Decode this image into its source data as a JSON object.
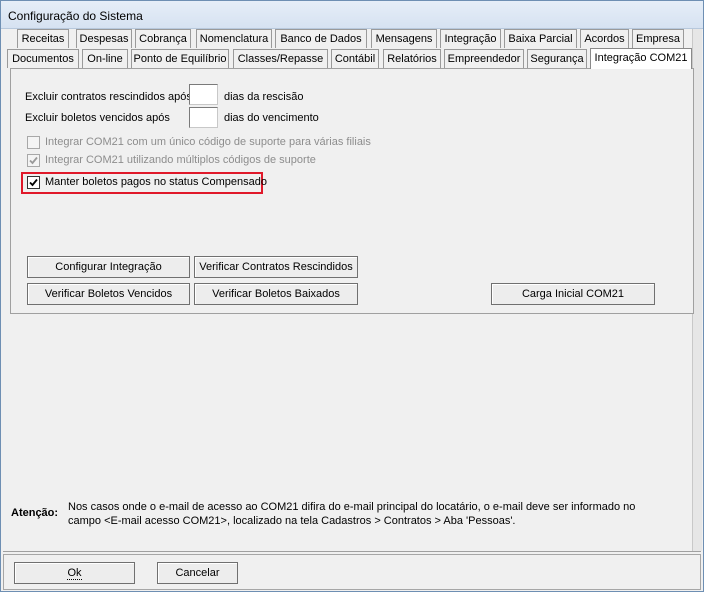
{
  "window": {
    "title": "Configuração do Sistema"
  },
  "tabs_row1": [
    "Receitas",
    "Despesas",
    "Cobrança",
    "Nomenclatura",
    "Banco de Dados",
    "Mensagens",
    "Integração",
    "Baixa Parcial",
    "Acordos",
    "Empresa"
  ],
  "tabs_row2": [
    "Documentos",
    "On-line",
    "Ponto de Equilíbrio",
    "Classes/Repasse",
    "Contábil",
    "Relatórios",
    "Empreendedor",
    "Segurança",
    "Integração COM21"
  ],
  "active_tab": "Integração COM21",
  "form": {
    "excluir_contratos_label": "Excluir contratos rescindidos após",
    "excluir_contratos_value": "",
    "excluir_contratos_suffix": "dias da rescisão",
    "excluir_boletos_label": "Excluir boletos vencidos  após",
    "excluir_boletos_value": "",
    "excluir_boletos_suffix": "dias do vencimento",
    "checkboxes": [
      {
        "label": "Integrar COM21 com um único código de suporte para várias filiais",
        "checked": false,
        "enabled": false
      },
      {
        "label": "Integrar COM21 utilizando múltiplos códigos de suporte",
        "checked": true,
        "enabled": false
      },
      {
        "label": "Manter boletos pagos no status Compensado",
        "checked": true,
        "enabled": true
      }
    ]
  },
  "buttons": {
    "configurar_integracao": "Configurar Integração",
    "verificar_contratos_rescindidos": "Verificar Contratos Rescindidos",
    "verificar_boletos_vencidos": "Verificar Boletos Vencidos",
    "verificar_boletos_baixados": "Verificar Boletos Baixados",
    "carga_inicial": "Carga Inicial COM21"
  },
  "note": {
    "heading": "Atenção:",
    "text": "Nos casos onde o e-mail de acesso ao COM21 difira do e-mail principal do locatário, o e-mail deve ser informado no campo <E-mail acesso COM21>, localizado na tela Cadastros > Contratos > Aba 'Pessoas'."
  },
  "footer": {
    "ok_label": "Ok",
    "cancel_label": "Cancelar"
  }
}
